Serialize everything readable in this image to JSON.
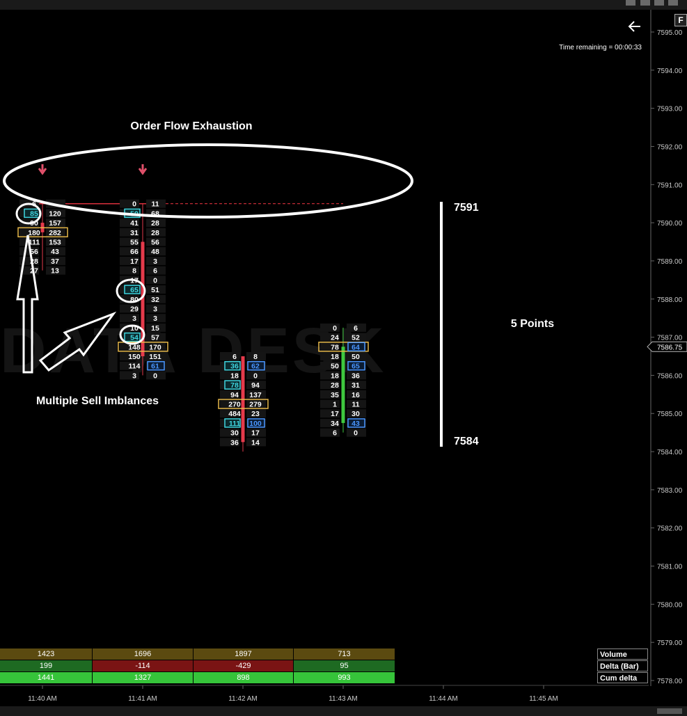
{
  "timer": {
    "text": "Time remaining = 00:00:33"
  },
  "price_axis": {
    "min": 7578.0,
    "max": 7595.0,
    "labels": [
      "7595.00",
      "7594.00",
      "7593.00",
      "7592.00",
      "7591.00",
      "7590.00",
      "7589.00",
      "7588.00",
      "7587.00",
      "7586.00",
      "7585.00",
      "7584.00",
      "7583.00",
      "7582.00",
      "7581.00",
      "7580.00",
      "7579.00",
      "7578.00"
    ],
    "current_price": "7586.75"
  },
  "time_axis": {
    "labels": [
      "11:40 AM",
      "11:41 AM",
      "11:42 AM",
      "11:43 AM",
      "11:44 AM",
      "11:45 AM"
    ]
  },
  "annotations": {
    "order_flow": "Order Flow Exhaustion",
    "multiple_sell": "Multiple Sell Imblances",
    "five_points": "5 Points",
    "upper_level": "7591",
    "lower_level": "7584"
  },
  "watermark": "DATA DESK",
  "f_button": "F",
  "colors": {
    "accent_sell": "#e53a4b",
    "accent_buy": "#3ec83e",
    "poc": "#e6b84a",
    "imb_bid": "#3fd6e0",
    "imb_ask": "#4a96ff"
  },
  "chart_data": {
    "type": "footprint",
    "price_tick": 0.25,
    "bars": [
      {
        "time": "11:40 AM",
        "open": 7590.0,
        "high": 7590.5,
        "low": 7588.75,
        "close": 7589.75,
        "direction": "down",
        "levels": [
          {
            "price": 7590.5,
            "bid": "6",
            "ask": ""
          },
          {
            "price": 7590.25,
            "bid": "85",
            "ask": "120",
            "bid_imb": true
          },
          {
            "price": 7590.0,
            "bid": "90",
            "ask": "157"
          },
          {
            "price": 7589.75,
            "bid": "180",
            "ask": "282",
            "poc": true
          },
          {
            "price": 7589.5,
            "bid": "111",
            "ask": "153"
          },
          {
            "price": 7589.25,
            "bid": "56",
            "ask": "43"
          },
          {
            "price": 7589.0,
            "bid": "28",
            "ask": "37"
          },
          {
            "price": 7588.75,
            "bid": "27",
            "ask": "13"
          }
        ]
      },
      {
        "time": "11:41 AM",
        "open": 7589.5,
        "high": 7590.5,
        "low": 7586.0,
        "close": 7586.5,
        "direction": "down",
        "levels": [
          {
            "price": 7590.5,
            "bid": "0",
            "ask": "11"
          },
          {
            "price": 7590.25,
            "bid": "50",
            "ask": "68",
            "bid_imb": true
          },
          {
            "price": 7590.0,
            "bid": "41",
            "ask": "28"
          },
          {
            "price": 7589.75,
            "bid": "31",
            "ask": "28"
          },
          {
            "price": 7589.5,
            "bid": "55",
            "ask": "56"
          },
          {
            "price": 7589.25,
            "bid": "66",
            "ask": "48"
          },
          {
            "price": 7589.0,
            "bid": "17",
            "ask": "3"
          },
          {
            "price": 7588.75,
            "bid": "8",
            "ask": "6"
          },
          {
            "price": 7588.5,
            "bid": "17",
            "ask": "0"
          },
          {
            "price": 7588.25,
            "bid": "65",
            "ask": "51",
            "bid_imb": true
          },
          {
            "price": 7588.0,
            "bid": "80",
            "ask": "32"
          },
          {
            "price": 7587.75,
            "bid": "29",
            "ask": "3"
          },
          {
            "price": 7587.5,
            "bid": "3",
            "ask": "3"
          },
          {
            "price": 7587.25,
            "bid": "10",
            "ask": "15"
          },
          {
            "price": 7587.0,
            "bid": "54",
            "ask": "57",
            "bid_imb": true
          },
          {
            "price": 7586.75,
            "bid": "148",
            "ask": "170",
            "poc": true
          },
          {
            "price": 7586.5,
            "bid": "150",
            "ask": "151"
          },
          {
            "price": 7586.25,
            "bid": "114",
            "ask": "61",
            "ask_imb": true
          },
          {
            "price": 7586.0,
            "bid": "3",
            "ask": "0"
          }
        ]
      },
      {
        "time": "11:42 AM",
        "open": 7586.5,
        "high": 7586.5,
        "low": 7584.0,
        "close": 7584.25,
        "direction": "down",
        "levels": [
          {
            "price": 7586.5,
            "bid": "6",
            "ask": "8"
          },
          {
            "price": 7586.25,
            "bid": "36",
            "ask": "62",
            "bid_imb": true,
            "ask_imb": true
          },
          {
            "price": 7586.0,
            "bid": "18",
            "ask": "0"
          },
          {
            "price": 7585.75,
            "bid": "78",
            "ask": "94",
            "bid_imb": true
          },
          {
            "price": 7585.5,
            "bid": "94",
            "ask": "137"
          },
          {
            "price": 7585.25,
            "bid": "270",
            "ask": "279",
            "poc": true
          },
          {
            "price": 7585.0,
            "bid": "484",
            "ask": "23"
          },
          {
            "price": 7584.75,
            "bid": "111",
            "ask": "100",
            "bid_imb": true,
            "ask_imb": true
          },
          {
            "price": 7584.5,
            "bid": "30",
            "ask": "17"
          },
          {
            "price": 7584.25,
            "bid": "36",
            "ask": "14"
          }
        ]
      },
      {
        "time": "11:43 AM",
        "open": 7584.75,
        "high": 7587.25,
        "low": 7584.5,
        "close": 7586.75,
        "direction": "up",
        "levels": [
          {
            "price": 7587.25,
            "bid": "0",
            "ask": "6"
          },
          {
            "price": 7587.0,
            "bid": "24",
            "ask": "52"
          },
          {
            "price": 7586.75,
            "bid": "78",
            "ask": "64",
            "poc": true,
            "ask_imb": true
          },
          {
            "price": 7586.5,
            "bid": "18",
            "ask": "50"
          },
          {
            "price": 7586.25,
            "bid": "50",
            "ask": "65",
            "ask_imb": true
          },
          {
            "price": 7586.0,
            "bid": "18",
            "ask": "36"
          },
          {
            "price": 7585.75,
            "bid": "28",
            "ask": "31"
          },
          {
            "price": 7585.5,
            "bid": "35",
            "ask": "16"
          },
          {
            "price": 7585.25,
            "bid": "1",
            "ask": "11"
          },
          {
            "price": 7585.0,
            "bid": "17",
            "ask": "30"
          },
          {
            "price": 7584.75,
            "bid": "34",
            "ask": "43",
            "ask_imb": true
          },
          {
            "price": 7584.5,
            "bid": "6",
            "ask": "0"
          }
        ]
      }
    ],
    "stats": {
      "rows": [
        {
          "name": "Volume",
          "values": [
            "1423",
            "1696",
            "1897",
            "713"
          ]
        },
        {
          "name": "Delta (Bar)",
          "values": [
            "199",
            "-114",
            "-429",
            "95"
          ]
        },
        {
          "name": "Cum delta",
          "values": [
            "1441",
            "1327",
            "898",
            "993"
          ]
        }
      ]
    },
    "horizontal_level": 7590.5
  }
}
